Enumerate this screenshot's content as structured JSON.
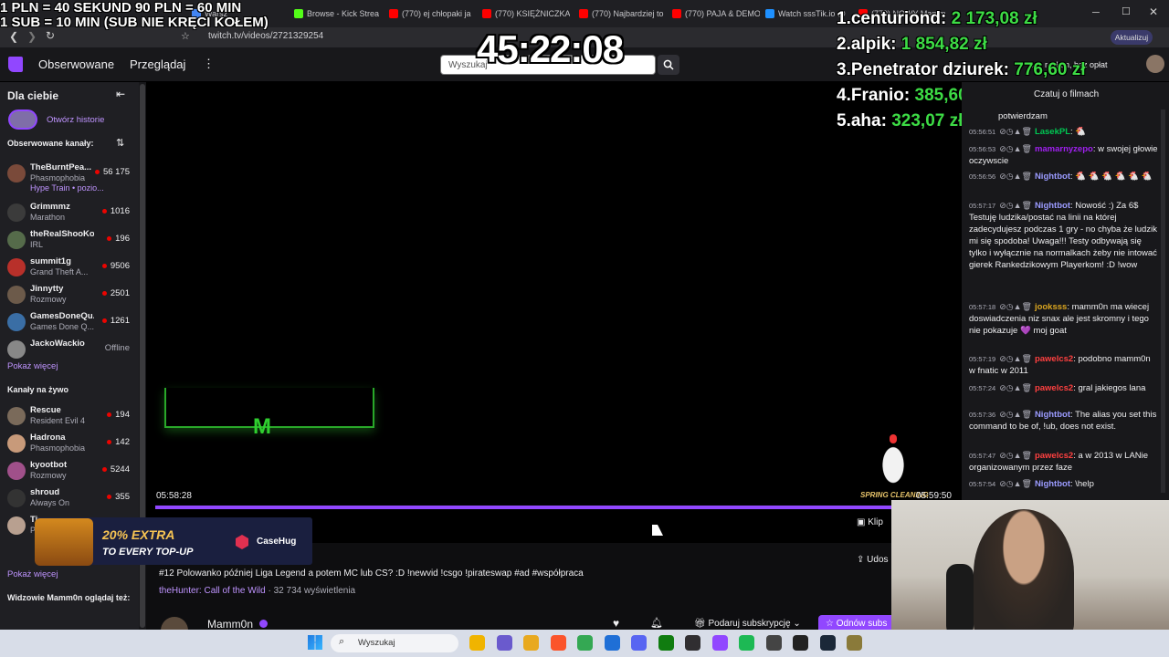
{
  "overlay": {
    "line1": "1 PLN = 40 SEKUND 90 PLN = 60 MIN",
    "line2": "1 SUB = 10 MIN (SUB NIE KRĘCI KOŁEM)",
    "timer": "45:22:08",
    "leaderboard": [
      {
        "rank": "1.",
        "name": "centuriond:",
        "amount": "2 173,08 zł"
      },
      {
        "rank": "2.",
        "name": "alpik:",
        "amount": "1 854,82 zł"
      },
      {
        "rank": "3.",
        "name": "Penetrator dziurek:",
        "amount": "776,60 zł"
      },
      {
        "rank": "4.",
        "name": "Franio:",
        "amount": "385,60 zł"
      },
      {
        "rank": "5.",
        "name": "aha:",
        "amount": "323,07 zł"
      }
    ]
  },
  "browser": {
    "tabs": [
      {
        "label": "Warsz",
        "color": "#4285f4"
      },
      {
        "label": "Browse - Kick Strea",
        "color": "#53fc18"
      },
      {
        "label": "(770) ej chłopaki ja",
        "color": "#ff0000"
      },
      {
        "label": "(770) KSIĘŻNICZKA",
        "color": "#ff0000"
      },
      {
        "label": "(770) Najbardziej to",
        "color": "#ff0000"
      },
      {
        "label": "(770) PAJA & DEMO",
        "color": "#ff0000"
      },
      {
        "label": "Watch sssTik.io @",
        "color": "#1e90ff"
      },
      {
        "label": "(770) NOWY Mamm",
        "color": "#ff0000"
      }
    ],
    "url": "twitch.tv/videos/2721329254",
    "update_label": "Aktualizuj"
  },
  "twitch_nav": {
    "followed": "Obserwowane",
    "browse": "Przeglądaj",
    "search_placeholder": "Wyszukaj",
    "ad_free": "Bez reklam, bez opłat"
  },
  "sidebar": {
    "for_you": "Dla ciebie",
    "open_history": "Otwórz historie",
    "followed_channels": "Obserwowane kanały:",
    "followed": [
      {
        "name": "TheBurntPea...",
        "game": "Phasmophobia",
        "viewers": "56 175",
        "extra": "Hype Train • pozio..."
      },
      {
        "name": "Grimmmz",
        "game": "Marathon",
        "viewers": "1016"
      },
      {
        "name": "theRealShooKo...",
        "game": "IRL",
        "viewers": "196"
      },
      {
        "name": "summit1g",
        "game": "Grand Theft A...",
        "viewers": "9506"
      },
      {
        "name": "Jinnytty",
        "game": "Rozmowy",
        "viewers": "2501"
      },
      {
        "name": "GamesDoneQu...",
        "game": "Games Done Q...",
        "viewers": "1261"
      },
      {
        "name": "JackoWackio",
        "game": "",
        "viewers": "Offline"
      }
    ],
    "show_more": "Pokaż więcej",
    "live_channels": "Kanały na żywo",
    "live": [
      {
        "name": "Rescue",
        "game": "Resident Evil 4",
        "viewers": "194"
      },
      {
        "name": "Hadrona",
        "game": "Phasmophobia",
        "viewers": "142"
      },
      {
        "name": "kyootbot",
        "game": "Rozmowy",
        "viewers": "5244"
      },
      {
        "name": "shroud",
        "game": "Always On",
        "viewers": "355"
      },
      {
        "name": "Tina",
        "game": "Po",
        "viewers": ""
      }
    ],
    "show_more2": "Pokaż więcej",
    "viewers_watch": "Widzowie Mamm0n oglądaj też:"
  },
  "player": {
    "position": "05:58:28",
    "end": "05:59:50",
    "progress_fraction": 0.962,
    "clip": "Klip",
    "share": "Udos",
    "game_text": "M",
    "spring": "SPRING CLEANING"
  },
  "video": {
    "title": "#12 Polowanko później Liga Legend a potem MC lub CS? :D !newvid !csgo !pirateswap #ad #współpraca",
    "category": "theHunter: Call of the Wild",
    "views": " · 32 734 wyświetlenia",
    "channel": "Mamm0n",
    "gift": "Podaruj subskrypcję",
    "renew": "Odnów subs"
  },
  "ad": {
    "line1": "20% EXTRA",
    "line2": "TO EVERY TOP-UP",
    "brand": "CaseHug"
  },
  "chat": {
    "header": "Czatuj o filmach",
    "messages": [
      {
        "time": "",
        "user": "",
        "color": "#efeff1",
        "text": "potwierdzam"
      },
      {
        "time": "05:56:51",
        "user": "LasekPL",
        "color": "#00c853",
        "text": ": 🐔"
      },
      {
        "time": "05:56:53",
        "user": "mamarnyzepo",
        "color": "#a020f0",
        "text": ": w swojej głowie oczywscie"
      },
      {
        "time": "05:56:56",
        "user": "Nightbot",
        "color": "#9b9bff",
        "text": ": 🐔 🐔 🐔 🐔 🐔 🐔"
      },
      {
        "time": "05:57:17",
        "user": "Nightbot",
        "color": "#9b9bff",
        "text": ": Nowość :) Za 6$ Testuję ludzika/postać na linii na której zadecydujesz podczas 1 gry - no chyba że ludzik mi się spodoba! Uwaga!!! Testy odbywają się tylko i wyłącznie na normalkach żeby nie intować gierek Rankedzikowym Playerkom! :D !wow"
      },
      {
        "time": "05:57:18",
        "user": "jooksss",
        "color": "#daa520",
        "text": ": mamm0n ma wiecej doswiadczenia niz snax ale jest skromny i tego nie pokazuje 💜 moj goat"
      },
      {
        "time": "05:57:19",
        "user": "pawelcs2",
        "color": "#ff4040",
        "text": ": podobno mamm0n w fnatic w 2011"
      },
      {
        "time": "05:57:24",
        "user": "pawelcs2",
        "color": "#ff4040",
        "text": ": gral jakiegos lana"
      },
      {
        "time": "05:57:36",
        "user": "Nightbot",
        "color": "#9b9bff",
        "text": ": The alias you set this command to be of, !ub, does not exist."
      },
      {
        "time": "05:57:47",
        "user": "pawelcs2",
        "color": "#ff4040",
        "text": ": a w 2013 w LANie organizowanym przez faze"
      },
      {
        "time": "05:57:54",
        "user": "Nightbot",
        "color": "#9b9bff",
        "text": ": \\help"
      }
    ]
  },
  "taskbar": {
    "search": "Wyszukaj"
  }
}
